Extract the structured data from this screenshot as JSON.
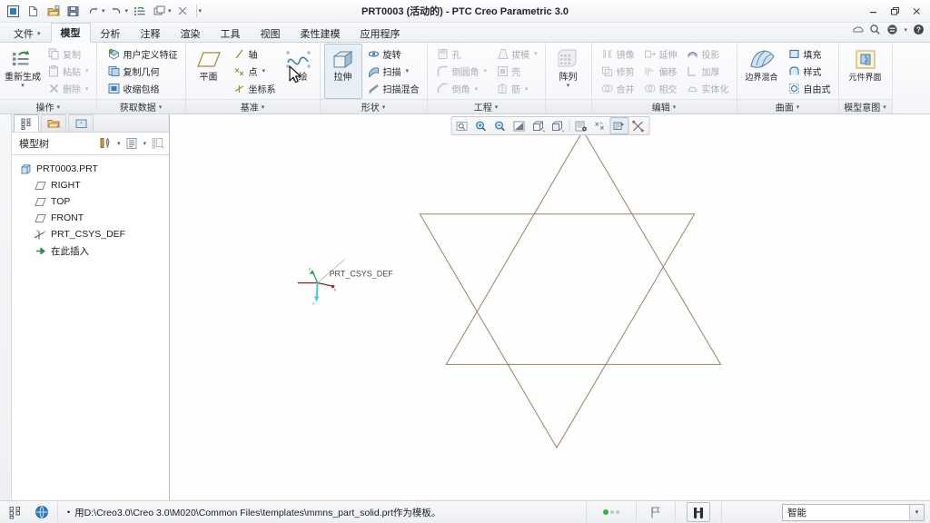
{
  "window": {
    "title": "PRT0003 (活动的) - PTC Creo Parametric 3.0",
    "minimize": "—",
    "restore": "❐",
    "close": "✕"
  },
  "qat": {
    "items": [
      {
        "name": "creo-app-icon",
        "glyph": "app"
      },
      {
        "name": "new-file-icon",
        "glyph": "new"
      },
      {
        "name": "open-file-icon",
        "glyph": "open"
      },
      {
        "name": "save-icon",
        "glyph": "save"
      },
      {
        "name": "undo-icon",
        "glyph": "undo"
      },
      {
        "name": "redo-icon",
        "glyph": "redo"
      },
      {
        "name": "regenerate-icon",
        "glyph": "regen"
      },
      {
        "name": "window-switch-icon",
        "glyph": "windows"
      },
      {
        "name": "close-window-icon",
        "glyph": "closewin"
      }
    ],
    "overflow_caret": "▾"
  },
  "titlebar_help": {
    "cloud_icon": "cloud-icon",
    "search_icon": "search-icon",
    "account_icon": "account-icon",
    "help_icon": "help-icon"
  },
  "ribbon": {
    "tabs": [
      {
        "label": "文件",
        "has_caret": true,
        "active": false
      },
      {
        "label": "模型",
        "has_caret": false,
        "active": true
      },
      {
        "label": "分析",
        "has_caret": false,
        "active": false
      },
      {
        "label": "注释",
        "has_caret": false,
        "active": false
      },
      {
        "label": "渲染",
        "has_caret": false,
        "active": false
      },
      {
        "label": "工具",
        "has_caret": false,
        "active": false
      },
      {
        "label": "视图",
        "has_caret": false,
        "active": false
      },
      {
        "label": "柔性建模",
        "has_caret": false,
        "active": false
      },
      {
        "label": "应用程序",
        "has_caret": false,
        "active": false
      }
    ],
    "groups": [
      {
        "label": "操作",
        "big": [
          {
            "label": "重新生成",
            "icon": "regenerate-icon",
            "caret": true,
            "disabled": false
          }
        ],
        "cols": [
          [
            {
              "label": "复制",
              "icon": "copy-icon",
              "caret": false,
              "disabled": true
            },
            {
              "label": "粘贴",
              "icon": "paste-icon",
              "caret": true,
              "disabled": true
            },
            {
              "label": "删除",
              "icon": "delete-icon",
              "caret": true,
              "disabled": true
            }
          ]
        ]
      },
      {
        "label": "获取数据",
        "big": [],
        "cols": [
          [
            {
              "label": "用户定义特征",
              "icon": "udf-icon",
              "caret": false,
              "disabled": false
            },
            {
              "label": "复制几何",
              "icon": "copy-geom-icon",
              "caret": false,
              "disabled": false
            },
            {
              "label": "收缩包络",
              "icon": "shrinkwrap-icon",
              "caret": false,
              "disabled": false
            }
          ]
        ]
      },
      {
        "label": "基准",
        "big": [
          {
            "label": "平面",
            "icon": "datum-plane-icon",
            "caret": false,
            "disabled": false
          }
        ],
        "cols": [
          [
            {
              "label": "轴",
              "icon": "axis-icon",
              "caret": false,
              "disabled": false
            },
            {
              "label": "点",
              "icon": "point-icon",
              "caret": true,
              "disabled": false
            },
            {
              "label": "坐标系",
              "icon": "csys-icon",
              "caret": false,
              "disabled": false
            }
          ]
        ],
        "big_right": [
          {
            "label": "草绘",
            "icon": "sketch-icon",
            "caret": false,
            "disabled": false
          }
        ]
      },
      {
        "label": "形状",
        "big": [
          {
            "label": "拉伸",
            "icon": "extrude-icon",
            "caret": false,
            "disabled": false,
            "pressed": true
          }
        ],
        "cols": [
          [
            {
              "label": "旋转",
              "icon": "revolve-icon",
              "caret": false,
              "disabled": false
            },
            {
              "label": "扫描",
              "icon": "sweep-icon",
              "caret": true,
              "disabled": false
            },
            {
              "label": "扫描混合",
              "icon": "swept-blend-icon",
              "caret": false,
              "disabled": false
            }
          ]
        ]
      },
      {
        "label": "工程",
        "big": [],
        "cols": [
          [
            {
              "label": "孔",
              "icon": "hole-icon",
              "caret": false,
              "disabled": true
            },
            {
              "label": "倒圆角",
              "icon": "round-icon",
              "caret": true,
              "disabled": true
            },
            {
              "label": "倒角",
              "icon": "chamfer-icon",
              "caret": true,
              "disabled": true
            }
          ],
          [
            {
              "label": "拔模",
              "icon": "draft-icon",
              "caret": true,
              "disabled": true
            },
            {
              "label": "壳",
              "icon": "shell-icon",
              "caret": false,
              "disabled": true
            },
            {
              "label": "筋",
              "icon": "rib-icon",
              "caret": true,
              "disabled": true
            }
          ]
        ]
      },
      {
        "label": "",
        "big": [
          {
            "label": "阵列",
            "icon": "pattern-icon",
            "caret": true,
            "disabled": true
          }
        ],
        "cols": []
      },
      {
        "label": "编辑",
        "big": [],
        "cols": [
          [
            {
              "label": "镜像",
              "icon": "mirror-icon",
              "caret": false,
              "disabled": true
            },
            {
              "label": "修剪",
              "icon": "trim-icon",
              "caret": false,
              "disabled": true
            },
            {
              "label": "合并",
              "icon": "merge-icon",
              "caret": false,
              "disabled": true
            }
          ],
          [
            {
              "label": "延伸",
              "icon": "extend-icon",
              "caret": false,
              "disabled": true
            },
            {
              "label": "偏移",
              "icon": "offset-icon",
              "caret": false,
              "disabled": true
            },
            {
              "label": "相交",
              "icon": "intersect-icon",
              "caret": false,
              "disabled": true
            }
          ],
          [
            {
              "label": "投影",
              "icon": "project-icon",
              "caret": false,
              "disabled": true
            },
            {
              "label": "加厚",
              "icon": "thicken-icon",
              "caret": false,
              "disabled": true
            },
            {
              "label": "实体化",
              "icon": "solidify-icon",
              "caret": false,
              "disabled": true
            }
          ]
        ]
      },
      {
        "label": "曲面",
        "big": [
          {
            "label": "边界混合",
            "icon": "boundary-blend-icon",
            "caret": false,
            "disabled": false
          }
        ],
        "cols": [
          [
            {
              "label": "填充",
              "icon": "fill-icon",
              "caret": false,
              "disabled": false
            },
            {
              "label": "样式",
              "icon": "style-icon",
              "caret": false,
              "disabled": false
            },
            {
              "label": "自由式",
              "icon": "freestyle-icon",
              "caret": false,
              "disabled": false
            }
          ]
        ]
      },
      {
        "label": "模型意图",
        "big": [
          {
            "label": "元件界面",
            "icon": "component-interface-icon",
            "caret": false,
            "disabled": false
          }
        ],
        "cols": []
      }
    ]
  },
  "tree": {
    "tabs": [
      {
        "name": "model-tree-tab",
        "icon": "tree-icon",
        "active": true
      },
      {
        "name": "folder-browser-tab",
        "icon": "folder-icon",
        "active": false
      },
      {
        "name": "favorites-tab",
        "icon": "favorites-icon",
        "active": false
      }
    ],
    "title": "模型树",
    "header_buttons": [
      {
        "name": "filter-tools-button",
        "icon": "tools-icon",
        "caret": true
      },
      {
        "name": "tree-settings-button",
        "icon": "list-icon",
        "caret": true
      },
      {
        "name": "tree-columns-button",
        "icon": "columns-icon",
        "caret": false
      }
    ],
    "nodes": [
      {
        "label": "PRT0003.PRT",
        "icon": "part-icon",
        "indent": 0
      },
      {
        "label": "RIGHT",
        "icon": "plane-icon",
        "indent": 1
      },
      {
        "label": "TOP",
        "icon": "plane-icon",
        "indent": 1
      },
      {
        "label": "FRONT",
        "icon": "plane-icon",
        "indent": 1
      },
      {
        "label": "PRT_CSYS_DEF",
        "icon": "csys-icon",
        "indent": 1
      },
      {
        "label": "在此插入",
        "icon": "insert-here-icon",
        "indent": 1
      }
    ]
  },
  "graphics_toolbar": {
    "buttons": [
      {
        "name": "refit-button",
        "icon": "refit-icon",
        "active": false
      },
      {
        "name": "zoom-in-button",
        "icon": "zoom-in-icon",
        "active": false
      },
      {
        "name": "zoom-out-button",
        "icon": "zoom-out-icon",
        "active": false
      },
      {
        "name": "repaint-button",
        "icon": "repaint-icon",
        "active": false
      },
      {
        "name": "display-style-button",
        "icon": "display-style-icon",
        "active": false
      },
      {
        "name": "saved-orientations-button",
        "icon": "orientation-icon",
        "active": false
      },
      {
        "name": "view-manager-button",
        "icon": "view-manager-icon",
        "active": false
      },
      {
        "name": "datum-display-button",
        "icon": "datum-display-icon",
        "active": false
      },
      {
        "name": "annotation-display-button",
        "icon": "annotation-display-icon",
        "active": true
      },
      {
        "name": "spin-center-button",
        "icon": "spin-center-icon",
        "active": false
      }
    ]
  },
  "model": {
    "csys_label": "PRT_CSYS_DEF",
    "axis_labels": {
      "x": "x",
      "y": "y",
      "z": "z"
    },
    "edge_color": "#9a8260",
    "background_color": "#fefefe"
  },
  "statusbar": {
    "left_buttons": [
      {
        "name": "model-tree-toggle",
        "icon": "tree-icon"
      },
      {
        "name": "browser-toggle",
        "icon": "globe-icon"
      }
    ],
    "message": "用D:\\Creo3.0\\Creo 3.0\\M020\\Common Files\\templates\\mmns_part_solid.prt作为模板。",
    "bullet": "•",
    "right_buttons": [
      {
        "name": "selection-status-indicator",
        "icon": "dots-icon"
      },
      {
        "name": "flag-button",
        "icon": "flag-icon"
      },
      {
        "name": "search-button",
        "icon": "binoculars-icon"
      }
    ],
    "filter_value": "智能",
    "filter_caret": "▾"
  }
}
